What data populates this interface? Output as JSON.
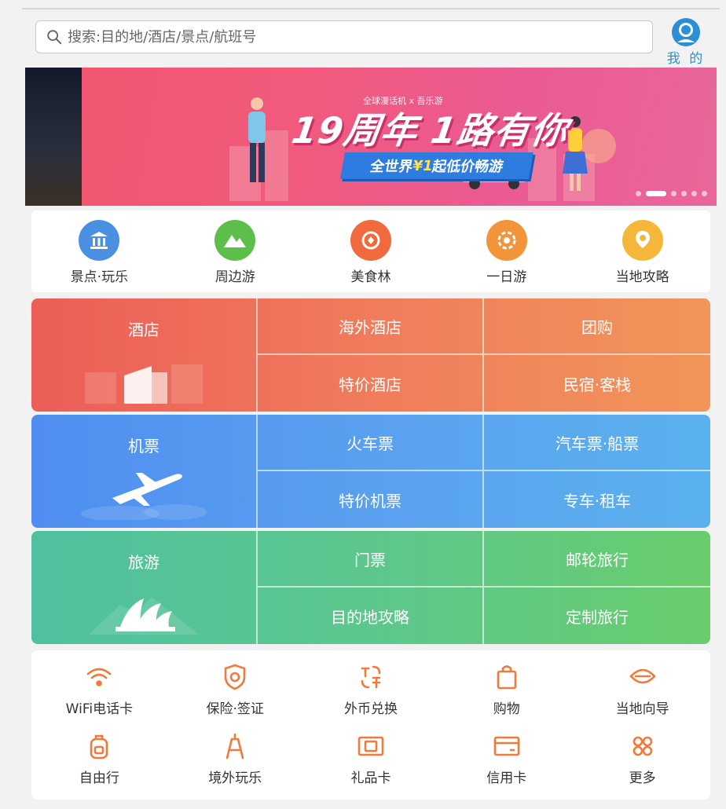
{
  "header": {
    "search_placeholder": "搜索:目的地/酒店/景点/航班号",
    "me_label": "我 的"
  },
  "banner": {
    "tagline": "全球漫话机 x 吾乐游",
    "headline": "19周年 1路有你",
    "ribbon_prefix": "全世界",
    "ribbon_price": "¥1",
    "ribbon_suffix": "起低价畅游",
    "slide_count": 6,
    "active_slide": 2
  },
  "quick_nav": [
    {
      "label": "景点·玩乐",
      "icon": "temple-icon",
      "color": "#4a90e2"
    },
    {
      "label": "周边游",
      "icon": "mountain-icon",
      "color": "#5bbf4a"
    },
    {
      "label": "美食林",
      "icon": "food-icon",
      "color": "#f06a3e"
    },
    {
      "label": "一日游",
      "icon": "badge-icon",
      "color": "#f2953a"
    },
    {
      "label": "当地攻略",
      "icon": "map-pin-icon",
      "color": "#f4b73a"
    }
  ],
  "grid": {
    "hotel": {
      "title": "酒店",
      "items": [
        "海外酒店",
        "团购",
        "特价酒店",
        "民宿·客栈"
      ]
    },
    "flight": {
      "title": "机票",
      "items": [
        "火车票",
        "汽车票·船票",
        "特价机票",
        "专车·租车"
      ]
    },
    "travel": {
      "title": "旅游",
      "items": [
        "门票",
        "邮轮旅行",
        "目的地攻略",
        "定制旅行"
      ]
    }
  },
  "services": [
    {
      "label": "WiFi电话卡",
      "icon": "wifi-icon"
    },
    {
      "label": "保险·签证",
      "icon": "shield-icon"
    },
    {
      "label": "外币兑换",
      "icon": "currency-exchange-icon"
    },
    {
      "label": "购物",
      "icon": "shopping-bag-icon"
    },
    {
      "label": "当地向导",
      "icon": "guide-icon"
    },
    {
      "label": "自由行",
      "icon": "backpack-icon"
    },
    {
      "label": "境外玩乐",
      "icon": "tower-icon"
    },
    {
      "label": "礼品卡",
      "icon": "gift-card-icon"
    },
    {
      "label": "信用卡",
      "icon": "credit-card-icon"
    },
    {
      "label": "更多",
      "icon": "more-icon"
    }
  ],
  "colors": {
    "accent_orange": "#f07a3c",
    "link_blue": "#2b8fd6"
  }
}
